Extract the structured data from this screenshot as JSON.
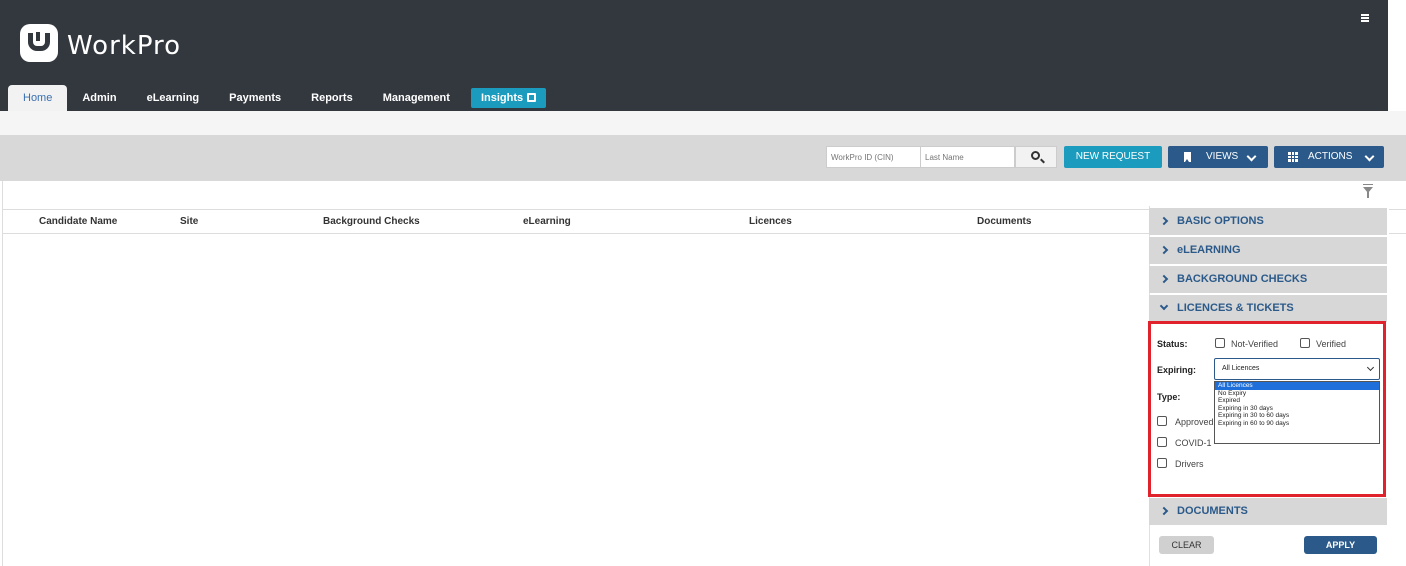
{
  "app": {
    "name": "WorkPro"
  },
  "nav": {
    "tabs": [
      "Home",
      "Admin",
      "eLearning",
      "Payments",
      "Reports",
      "Management",
      "Insights"
    ]
  },
  "toolbar": {
    "cin_placeholder": "WorkPro ID (CIN)",
    "lastname_placeholder": "Last Name",
    "new_request": "NEW REQUEST",
    "views": "VIEWS",
    "actions": "ACTIONS"
  },
  "table": {
    "columns": [
      "Candidate Name",
      "Site",
      "Background Checks",
      "eLearning",
      "Licences",
      "Documents"
    ]
  },
  "filters": {
    "sections": {
      "basic": "BASIC OPTIONS",
      "elearning": "eLEARNING",
      "background": "BACKGROUND CHECKS",
      "licences": "LICENCES & TICKETS",
      "documents": "DOCUMENTS"
    },
    "status_label": "Status:",
    "status_options": [
      "Not-Verified",
      "Verified"
    ],
    "expiring_label": "Expiring:",
    "expiring_value": "All Licences",
    "expiring_options": [
      "All Licences",
      "No Expiry",
      "Expired",
      "Expiring in 30 days",
      "Expiring in 30 to 60 days",
      "Expiring in 60 to 90 days"
    ],
    "type_label": "Type:",
    "type_options": [
      "Approved",
      "COVID-1",
      "Drivers"
    ],
    "clear": "CLEAR",
    "apply": "APPLY"
  },
  "colors": {
    "header": "#33383f",
    "accent": "#1b9bbd",
    "primary": "#2b5a8a",
    "highlight": "#e0222c"
  }
}
